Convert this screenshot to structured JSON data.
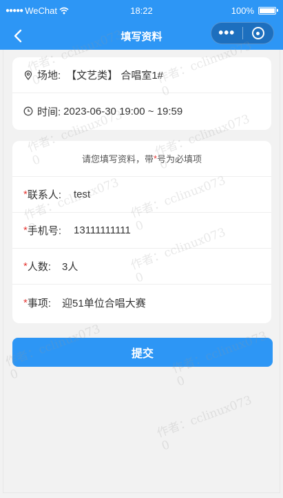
{
  "status_bar": {
    "carrier": "WeChat",
    "time": "18:22",
    "battery": "100%"
  },
  "nav": {
    "title": "填写资料"
  },
  "booking": {
    "venue_label": "场地:",
    "venue_value": "【文艺类】 合唱室1#",
    "time_label": "时间:",
    "time_value": "2023-06-30 19:00 ~ 19:59"
  },
  "form": {
    "notice_before": "请您填写资料，带",
    "notice_star": "*",
    "notice_after": "号为必填项",
    "required_mark": "*",
    "contact_label": "联系人:",
    "contact_value": "test",
    "phone_label": "手机号:",
    "phone_value": "13111111111",
    "people_label": "人数:",
    "people_value": "3人",
    "matter_label": "事项:",
    "matter_value": "迎51单位合唱大赛"
  },
  "submit_label": "提交",
  "watermark": "作者：cclinux073\n0",
  "colors": {
    "primary": "#2d96f5",
    "required": "#e53935",
    "background": "#f2f2f2"
  }
}
